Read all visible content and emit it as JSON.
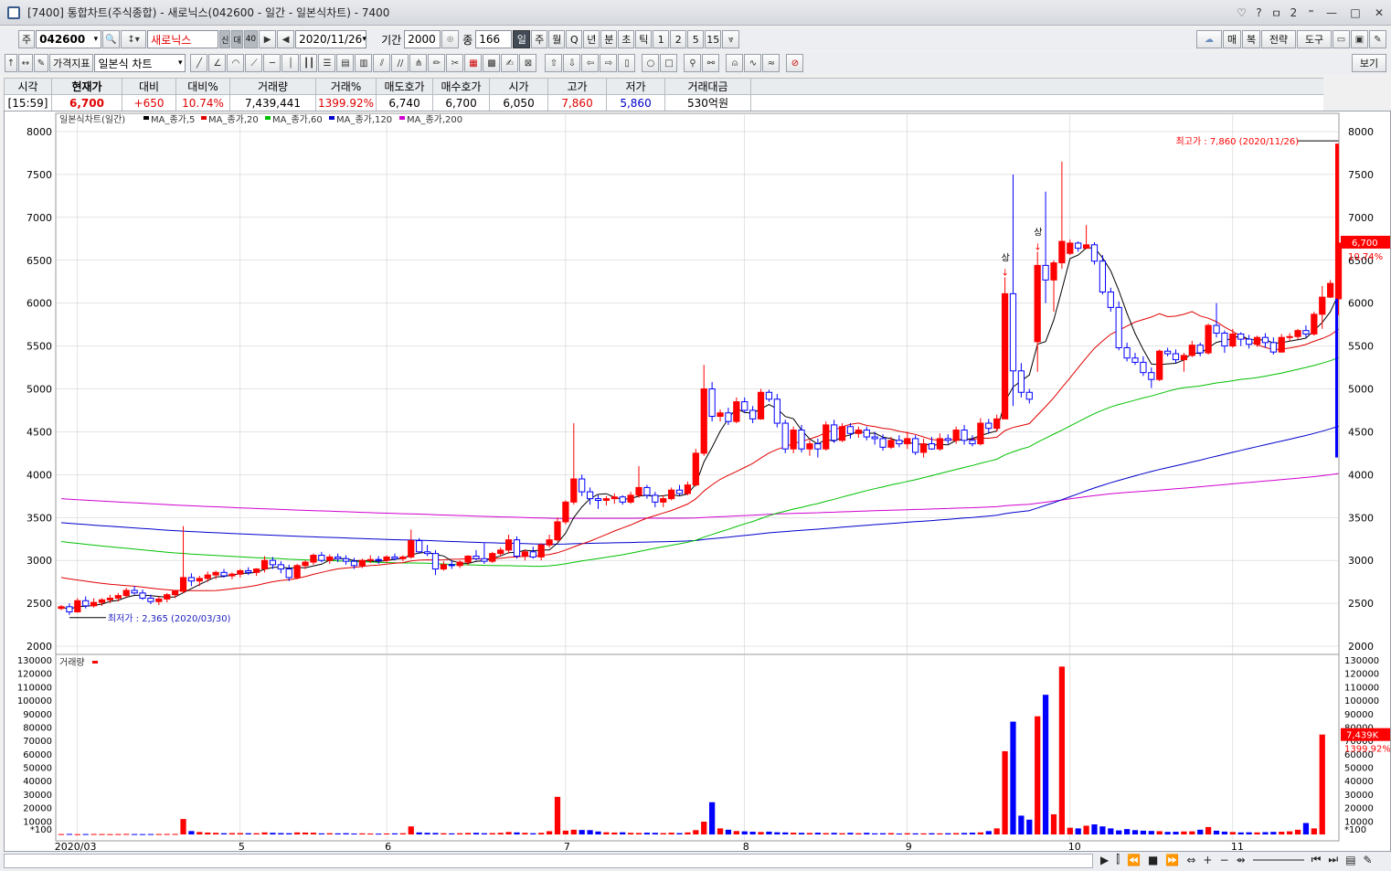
{
  "window": {
    "title": "[7400] 통합차트(주식종합) - 새로닉스(042600 - 일간 - 일본식차트) - 7400",
    "controls": [
      "♡",
      "?",
      "ㅁ",
      "2",
      "⁼",
      "—",
      "□",
      "✕"
    ]
  },
  "toolbar1": {
    "market": "주",
    "code": "042600",
    "name": "새로닉스",
    "name_tags": [
      "신",
      "대",
      "40"
    ],
    "date": "2020/11/26",
    "period_label": "기간",
    "period_value": "2000",
    "count_label": "종",
    "count_value": "166",
    "periods": [
      "일",
      "주",
      "월",
      "Q",
      "년",
      "분",
      "초",
      "틱",
      "1",
      "2",
      "5",
      "15"
    ],
    "right_buttons": [
      "매",
      "복",
      "전략",
      "도구"
    ]
  },
  "toolbar2": {
    "indicator_label": "가격지표",
    "chart_type": "일본식 차트",
    "view_label": "보기"
  },
  "quote": {
    "headers": [
      "시각",
      "현재가",
      "대비",
      "대비%",
      "거래량",
      "거래%",
      "매도호가",
      "매수호가",
      "시가",
      "고가",
      "저가",
      "거래대금"
    ],
    "values": [
      "[15:59]",
      "6,700",
      "+650",
      "10.74%",
      "7,439,441",
      "1399.92%",
      "6,740",
      "6,700",
      "6,050",
      "7,860",
      "5,860",
      "530억원"
    ]
  },
  "chart_data": {
    "type": "candlestick",
    "legend_text": "일본식차트(일간)",
    "ma_legend": [
      {
        "name": "MA_종가,5",
        "color": "#000000"
      },
      {
        "name": "MA_종가,20",
        "color": "#e00000"
      },
      {
        "name": "MA_종가,60",
        "color": "#00c000"
      },
      {
        "name": "MA_종가,120",
        "color": "#0000cc"
      },
      {
        "name": "MA_종가,200",
        "color": "#d000d0"
      }
    ],
    "colors": {
      "up": "#ff0000",
      "down": "#0000ff",
      "grid": "#c8c8c8"
    },
    "ylim": [
      2000,
      8000
    ],
    "yticks": [
      2000,
      2500,
      3000,
      3500,
      4000,
      4500,
      5000,
      5500,
      6000,
      6500,
      7000,
      7500,
      8000
    ],
    "xlabels": [
      "2020/03",
      "5",
      "6",
      "7",
      "8",
      "9",
      "10",
      "11"
    ],
    "xlabel_index": [
      2,
      22,
      40,
      62,
      84,
      104,
      124,
      144
    ],
    "high_note": "최고가 : 7,860 (2020/11/26)",
    "low_note": "최저가 : 2,365 (2020/03/30)",
    "markers": [
      "상",
      "상"
    ],
    "last_price_label": "6,700",
    "last_pct_label": "10.74%",
    "candles": [
      [
        2440,
        2480,
        2420,
        2460
      ],
      [
        2460,
        2500,
        2365,
        2400
      ],
      [
        2400,
        2560,
        2390,
        2530
      ],
      [
        2530,
        2580,
        2440,
        2470
      ],
      [
        2470,
        2560,
        2450,
        2510
      ],
      [
        2510,
        2560,
        2470,
        2540
      ],
      [
        2540,
        2600,
        2500,
        2560
      ],
      [
        2560,
        2620,
        2520,
        2590
      ],
      [
        2590,
        2680,
        2560,
        2650
      ],
      [
        2650,
        2700,
        2600,
        2620
      ],
      [
        2620,
        2660,
        2540,
        2560
      ],
      [
        2560,
        2600,
        2490,
        2520
      ],
      [
        2520,
        2580,
        2480,
        2550
      ],
      [
        2550,
        2620,
        2510,
        2600
      ],
      [
        2600,
        2650,
        2560,
        2640
      ],
      [
        2640,
        3400,
        2620,
        2800
      ],
      [
        2800,
        2850,
        2700,
        2760
      ],
      [
        2760,
        2820,
        2700,
        2790
      ],
      [
        2790,
        2870,
        2750,
        2830
      ],
      [
        2830,
        2880,
        2780,
        2860
      ],
      [
        2860,
        2900,
        2800,
        2820
      ],
      [
        2820,
        2860,
        2780,
        2840
      ],
      [
        2840,
        2900,
        2800,
        2880
      ],
      [
        2880,
        2920,
        2830,
        2860
      ],
      [
        2860,
        2910,
        2820,
        2900
      ],
      [
        2900,
        3050,
        2860,
        3000
      ],
      [
        3000,
        3040,
        2900,
        2950
      ],
      [
        2950,
        2990,
        2850,
        2900
      ],
      [
        2900,
        2950,
        2760,
        2800
      ],
      [
        2800,
        2960,
        2780,
        2940
      ],
      [
        2940,
        3000,
        2900,
        2980
      ],
      [
        2980,
        3080,
        2950,
        3060
      ],
      [
        3060,
        3100,
        2980,
        3000
      ],
      [
        3000,
        3070,
        2960,
        3040
      ],
      [
        3040,
        3080,
        2980,
        3020
      ],
      [
        3020,
        3060,
        2950,
        2990
      ],
      [
        2990,
        3030,
        2900,
        2940
      ],
      [
        2940,
        3020,
        2910,
        3000
      ],
      [
        3000,
        3060,
        2970,
        3010
      ],
      [
        3010,
        3050,
        2960,
        3000
      ],
      [
        3000,
        3060,
        2970,
        3040
      ],
      [
        3040,
        3080,
        3000,
        3020
      ],
      [
        3020,
        3060,
        2990,
        3040
      ],
      [
        3040,
        3360,
        3020,
        3230
      ],
      [
        3230,
        3260,
        3080,
        3100
      ],
      [
        3100,
        3180,
        3050,
        3080
      ],
      [
        3080,
        3120,
        2830,
        2900
      ],
      [
        2900,
        2990,
        2880,
        2950
      ],
      [
        2950,
        3000,
        2900,
        2940
      ],
      [
        2940,
        3000,
        2910,
        2980
      ],
      [
        2980,
        3060,
        2940,
        3050
      ],
      [
        3050,
        3120,
        3000,
        3020
      ],
      [
        3020,
        3200,
        2960,
        2990
      ],
      [
        2990,
        3100,
        2970,
        3080
      ],
      [
        3080,
        3150,
        3050,
        3120
      ],
      [
        3120,
        3300,
        3080,
        3240
      ],
      [
        3240,
        3280,
        3020,
        3050
      ],
      [
        3050,
        3130,
        3000,
        3100
      ],
      [
        3100,
        3160,
        3020,
        3040
      ],
      [
        3040,
        3200,
        3000,
        3180
      ],
      [
        3180,
        3300,
        3150,
        3240
      ],
      [
        3240,
        3500,
        3220,
        3450
      ],
      [
        3450,
        3700,
        3420,
        3680
      ],
      [
        3680,
        4600,
        3650,
        3950
      ],
      [
        3950,
        4000,
        3750,
        3800
      ],
      [
        3800,
        3850,
        3650,
        3720
      ],
      [
        3720,
        3760,
        3600,
        3700
      ],
      [
        3700,
        3750,
        3640,
        3720
      ],
      [
        3720,
        3780,
        3660,
        3740
      ],
      [
        3740,
        3760,
        3650,
        3680
      ],
      [
        3680,
        3800,
        3660,
        3760
      ],
      [
        3760,
        4100,
        3730,
        3850
      ],
      [
        3850,
        3880,
        3720,
        3760
      ],
      [
        3760,
        3800,
        3620,
        3680
      ],
      [
        3680,
        3760,
        3620,
        3720
      ],
      [
        3720,
        3850,
        3700,
        3820
      ],
      [
        3820,
        3880,
        3760,
        3780
      ],
      [
        3780,
        3920,
        3760,
        3880
      ],
      [
        3880,
        4300,
        3860,
        4250
      ],
      [
        4250,
        5280,
        4220,
        5000
      ],
      [
        5000,
        5080,
        4620,
        4680
      ],
      [
        4680,
        4760,
        4620,
        4720
      ],
      [
        4720,
        4780,
        4580,
        4620
      ],
      [
        4620,
        4900,
        4600,
        4850
      ],
      [
        4850,
        4900,
        4720,
        4750
      ],
      [
        4750,
        4800,
        4600,
        4650
      ],
      [
        4650,
        5000,
        4640,
        4960
      ],
      [
        4960,
        4990,
        4850,
        4880
      ],
      [
        4880,
        4940,
        4550,
        4600
      ],
      [
        4600,
        4640,
        4250,
        4300
      ],
      [
        4300,
        4560,
        4250,
        4520
      ],
      [
        4520,
        4580,
        4260,
        4300
      ],
      [
        4300,
        4400,
        4220,
        4360
      ],
      [
        4360,
        4420,
        4200,
        4300
      ],
      [
        4300,
        4620,
        4280,
        4580
      ],
      [
        4580,
        4640,
        4370,
        4400
      ],
      [
        4400,
        4600,
        4380,
        4560
      ],
      [
        4560,
        4600,
        4420,
        4480
      ],
      [
        4480,
        4560,
        4430,
        4520
      ],
      [
        4520,
        4560,
        4400,
        4440
      ],
      [
        4440,
        4500,
        4350,
        4420
      ],
      [
        4420,
        4470,
        4280,
        4320
      ],
      [
        4320,
        4440,
        4300,
        4400
      ],
      [
        4400,
        4460,
        4320,
        4360
      ],
      [
        4360,
        4500,
        4300,
        4420
      ],
      [
        4420,
        4460,
        4230,
        4260
      ],
      [
        4260,
        4420,
        4200,
        4360
      ],
      [
        4360,
        4440,
        4290,
        4300
      ],
      [
        4300,
        4480,
        4280,
        4420
      ],
      [
        4420,
        4470,
        4360,
        4400
      ],
      [
        4400,
        4560,
        4360,
        4520
      ],
      [
        4520,
        4580,
        4350,
        4400
      ],
      [
        4400,
        4460,
        4330,
        4360
      ],
      [
        4360,
        4660,
        4340,
        4600
      ],
      [
        4600,
        4650,
        4480,
        4540
      ],
      [
        4540,
        4700,
        4500,
        4650
      ],
      [
        4650,
        6300,
        5200,
        6110
      ],
      [
        6110,
        7500,
        4800,
        5210
      ],
      [
        5210,
        5300,
        4900,
        4960
      ],
      [
        4960,
        5000,
        4830,
        4880
      ],
      [
        5550,
        6600,
        5200,
        6440
      ],
      [
        6440,
        7300,
        6000,
        6270
      ],
      [
        6270,
        6500,
        5900,
        6470
      ],
      [
        6470,
        7650,
        6400,
        6720
      ],
      [
        6580,
        6740,
        6560,
        6700
      ],
      [
        6700,
        6720,
        6600,
        6640
      ],
      [
        6640,
        6910,
        6630,
        6680
      ],
      [
        6680,
        6710,
        6450,
        6490
      ],
      [
        6490,
        6560,
        6100,
        6130
      ],
      [
        6130,
        6180,
        5900,
        5950
      ],
      [
        5950,
        6020,
        5450,
        5480
      ],
      [
        5480,
        5540,
        5320,
        5360
      ],
      [
        5360,
        5420,
        5280,
        5310
      ],
      [
        5310,
        5380,
        5150,
        5190
      ],
      [
        5190,
        5250,
        5010,
        5110
      ],
      [
        5110,
        5460,
        5090,
        5440
      ],
      [
        5440,
        5480,
        5380,
        5410
      ],
      [
        5410,
        5460,
        5300,
        5340
      ],
      [
        5340,
        5420,
        5200,
        5390
      ],
      [
        5390,
        5560,
        5370,
        5510
      ],
      [
        5510,
        5540,
        5380,
        5420
      ],
      [
        5420,
        5760,
        5400,
        5740
      ],
      [
        5740,
        6000,
        5600,
        5650
      ],
      [
        5650,
        5680,
        5420,
        5500
      ],
      [
        5500,
        5700,
        5480,
        5640
      ],
      [
        5640,
        5660,
        5500,
        5580
      ],
      [
        5580,
        5630,
        5470,
        5520
      ],
      [
        5520,
        5620,
        5490,
        5600
      ],
      [
        5600,
        5650,
        5480,
        5540
      ],
      [
        5540,
        5600,
        5400,
        5430
      ],
      [
        5430,
        5640,
        5420,
        5600
      ],
      [
        5600,
        5650,
        5560,
        5610
      ],
      [
        5610,
        5700,
        5580,
        5680
      ],
      [
        5680,
        5740,
        5600,
        5640
      ],
      [
        5640,
        5900,
        5620,
        5870
      ],
      [
        5870,
        6200,
        5700,
        6070
      ],
      [
        6070,
        6270,
        6060,
        6230
      ],
      [
        6050,
        7860,
        5860,
        6700
      ]
    ],
    "volume_ylim": [
      0,
      130000
    ],
    "volume_yticks": [
      10000,
      20000,
      30000,
      40000,
      50000,
      60000,
      70000,
      80000,
      90000,
      100000,
      110000,
      120000,
      130000
    ],
    "volume_legend": "거래량",
    "volume_unit": "*100",
    "volume_last_label": "7,439K",
    "volume_pct_label": "1399.92%",
    "volumes": [
      300,
      400,
      200,
      300,
      350,
      300,
      250,
      300,
      400,
      300,
      250,
      300,
      300,
      350,
      400,
      11500,
      2500,
      1800,
      1400,
      1200,
      900,
      1000,
      1000,
      900,
      900,
      1500,
      1200,
      1000,
      900,
      1500,
      1400,
      1300,
      800,
      900,
      800,
      900,
      700,
      800,
      700,
      600,
      700,
      800,
      900,
      6000,
      1500,
      1200,
      1100,
      900,
      800,
      900,
      1100,
      1200,
      900,
      1000,
      1200,
      1800,
      1500,
      1200,
      900,
      1200,
      2400,
      28000,
      2800,
      3500,
      3300,
      3200,
      2200,
      1600,
      1400,
      1600,
      1200,
      1100,
      1300,
      1200,
      1000,
      1300,
      1000,
      1500,
      3200,
      9500,
      24000,
      4500,
      3500,
      2500,
      2300,
      2000,
      1800,
      2100,
      1600,
      1500,
      1300,
      1200,
      1100,
      1300,
      1000,
      1200,
      900,
      1200,
      900,
      1200,
      800,
      900,
      1000,
      700,
      900,
      800,
      800,
      900,
      800,
      900,
      1000,
      1100,
      1300,
      1500,
      2500,
      4500,
      62000,
      84000,
      14000,
      11000,
      88000,
      104000,
      15000,
      125000,
      5000,
      4500,
      6500,
      7500,
      6000,
      4500,
      3000,
      4000,
      3200,
      2800,
      2600,
      2400,
      1900,
      2000,
      2200,
      2300,
      3500,
      5500,
      2800,
      2100,
      1800,
      1500,
      1600,
      1500,
      1700,
      1900,
      2000,
      2300,
      3500,
      8500,
      4500,
      74394
    ]
  }
}
